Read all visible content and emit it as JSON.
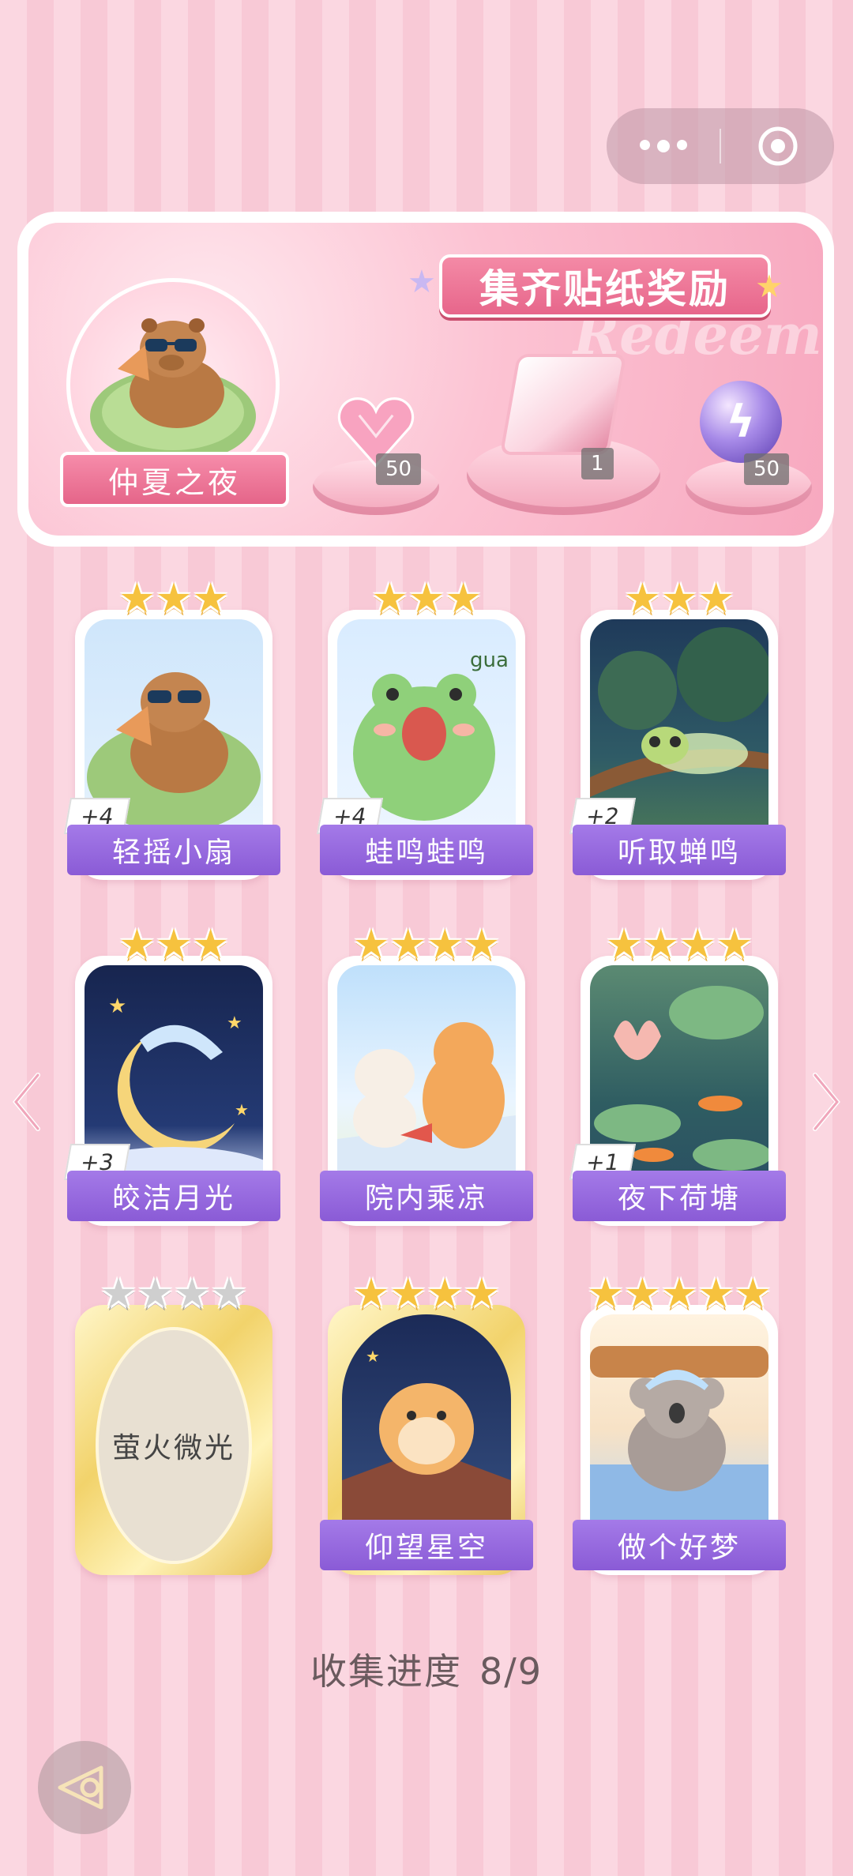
{
  "banner": {
    "title": "集齐贴纸奖励",
    "watermark": "Redeem",
    "collection_name": "仲夏之夜",
    "rewards": [
      {
        "icon": "pink-heart-gem-icon",
        "count": "50"
      },
      {
        "icon": "gift-box-icon",
        "count": "1"
      },
      {
        "icon": "lightning-orb-icon",
        "count": "50"
      }
    ]
  },
  "cards": [
    {
      "label": "轻摇小扇",
      "stars": 3,
      "bonus": "+4",
      "locked": false
    },
    {
      "label": "蛙鸣蛙鸣",
      "stars": 3,
      "bonus": "+4",
      "locked": false
    },
    {
      "label": "听取蝉鸣",
      "stars": 3,
      "bonus": "+2",
      "locked": false
    },
    {
      "label": "皎洁月光",
      "stars": 3,
      "bonus": "+3",
      "locked": false
    },
    {
      "label": "院内乘凉",
      "stars": 4,
      "bonus": "",
      "locked": false
    },
    {
      "label": "夜下荷塘",
      "stars": 4,
      "bonus": "+1",
      "locked": false
    },
    {
      "label": "萤火微光",
      "stars": 4,
      "bonus": "",
      "locked": true
    },
    {
      "label": "仰望星空",
      "stars": 4,
      "bonus": "",
      "locked": false
    },
    {
      "label": "做个好梦",
      "stars": 5,
      "bonus": "",
      "locked": false
    }
  ],
  "progress": {
    "label": "收集进度",
    "value": "8/9"
  },
  "colors": {
    "accent_purple": "#8a5bd6",
    "banner_pink": "#e7668b",
    "star_gold": "#f6c23e"
  }
}
